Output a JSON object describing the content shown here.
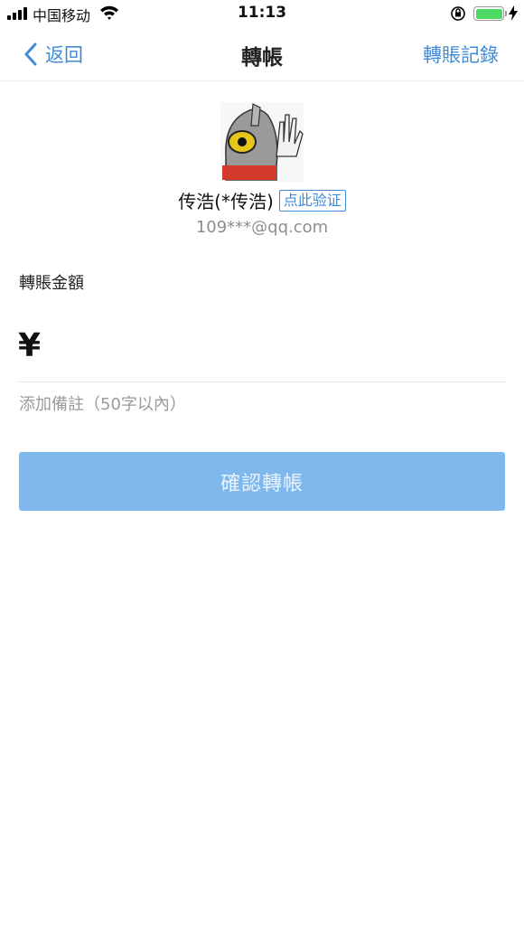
{
  "status_bar": {
    "carrier": "中国移动",
    "time": "11:13",
    "battery_level": 1.0,
    "icons": [
      "signal-icon",
      "wifi-icon",
      "orientation-lock-icon",
      "battery-icon",
      "charging-bolt-icon"
    ]
  },
  "nav": {
    "back_label": "返回",
    "title": "轉帳",
    "records_label": "轉賬記錄"
  },
  "profile": {
    "name": "传浩(*传浩)",
    "verify_label": "点此验证",
    "email": "109***@qq.com"
  },
  "form": {
    "amount_label": "轉賬金額",
    "currency_symbol": "¥",
    "amount_value": "",
    "note_placeholder": "添加備註（50字以內）",
    "note_value": ""
  },
  "actions": {
    "confirm_label": "確認轉帳"
  },
  "colors": {
    "accent": "#3f8bd6",
    "button_bg": "#7fb8ec",
    "button_text": "#e8f3fd",
    "battery": "#4cd964"
  }
}
